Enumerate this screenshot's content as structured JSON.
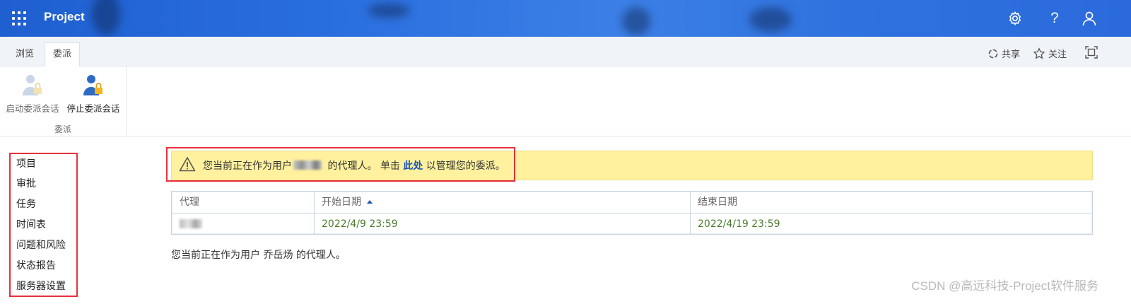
{
  "app": {
    "title": "Project"
  },
  "topbar": {
    "icons": [
      "waffle-icon",
      "gear-icon",
      "help-icon",
      "user-icon"
    ],
    "help_glyph": "?"
  },
  "ribbon": {
    "tabs": [
      {
        "label": "浏览",
        "active": false
      },
      {
        "label": "委派",
        "active": true
      }
    ],
    "actions": {
      "share_label": "共享",
      "follow_label": "关注"
    },
    "group": {
      "label": "委派",
      "buttons": [
        {
          "label": "启动委派会话",
          "enabled": false,
          "icon": "start-delegate-icon"
        },
        {
          "label": "停止委派会话",
          "enabled": true,
          "icon": "stop-delegate-icon"
        }
      ]
    }
  },
  "leftnav": {
    "items": [
      {
        "label": "项目"
      },
      {
        "label": "审批"
      },
      {
        "label": "任务"
      },
      {
        "label": "时间表"
      },
      {
        "label": "问题和风险"
      },
      {
        "label": "状态报告"
      },
      {
        "label": "服务器设置"
      }
    ]
  },
  "banner": {
    "text_before": "您当前正在作为用户",
    "text_middle": " 的代理人。 单击 ",
    "link": "此处",
    "text_after": " 以管理您的委派。"
  },
  "grid": {
    "columns": [
      {
        "label": "代理",
        "sorted": false
      },
      {
        "label": "开始日期",
        "sorted": "asc"
      },
      {
        "label": "结束日期",
        "sorted": false
      }
    ],
    "rows": [
      {
        "start": "2022/4/9 23:59",
        "end": "2022/4/19 23:59"
      }
    ]
  },
  "status": {
    "text": "您当前正在作为用户 乔岳炀 的代理人。"
  },
  "watermark": {
    "text": "CSDN @高远科技-Project软件服务"
  },
  "colors": {
    "suite_bar": "#2a6fdf",
    "warning_bg": "#fff19e",
    "highlight_border": "#e8303a",
    "link": "#1a56b8",
    "date_text": "#4a7a2d"
  }
}
